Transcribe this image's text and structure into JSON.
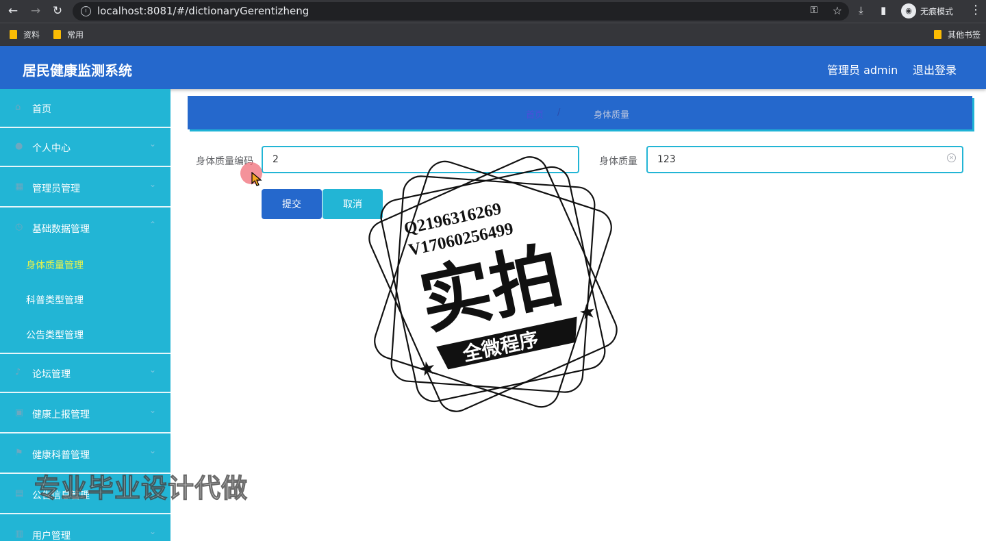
{
  "browser": {
    "url": "localhost:8081/#/dictionaryGerentizheng",
    "incognito_label": "无痕模式",
    "bookmarks": [
      "资料",
      "常用"
    ],
    "other_bookmarks": "其他书签"
  },
  "header": {
    "title": "居民健康监测系统",
    "user_label": "管理员 admin",
    "logout_label": "退出登录"
  },
  "sidebar": {
    "items": [
      {
        "label": "首页"
      },
      {
        "label": "个人中心"
      },
      {
        "label": "管理员管理"
      },
      {
        "label": "基础数据管理"
      },
      {
        "label": "论坛管理"
      },
      {
        "label": "健康上报管理"
      },
      {
        "label": "健康科普管理"
      },
      {
        "label": "公告信息管理"
      },
      {
        "label": "用户管理"
      }
    ],
    "subitems": [
      {
        "label": "身体质量管理",
        "active": true
      },
      {
        "label": "科普类型管理"
      },
      {
        "label": "公告类型管理"
      }
    ]
  },
  "breadcrumb": {
    "home": "首页",
    "separator": "/",
    "current": "身体质量"
  },
  "form": {
    "code_label": "身体质量编码",
    "code_value": "2",
    "quality_label": "身体质量",
    "quality_value": "123",
    "submit_label": "提交",
    "cancel_label": "取消"
  },
  "watermark": {
    "qq": "Q2196316269",
    "wechat": "V17060256499",
    "big_text": "实拍",
    "banner_text": "全微程序",
    "promo_text": "专业毕业设计代做"
  },
  "colors": {
    "header_bg": "#2568cc",
    "sidebar_bg": "#22b5d5",
    "active_submenu": "#eaf34a"
  }
}
